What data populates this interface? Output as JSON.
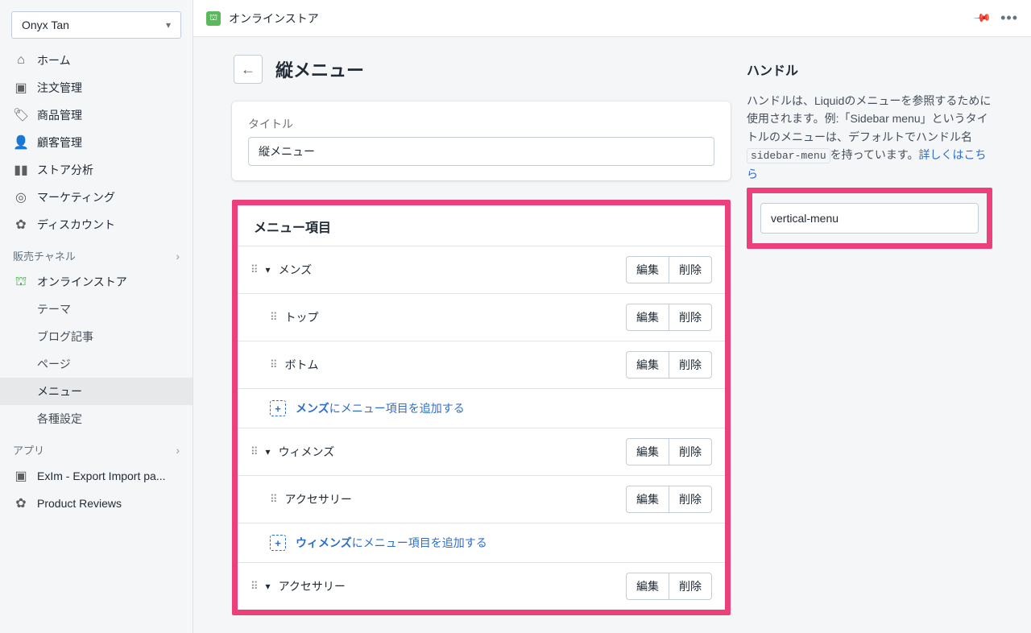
{
  "store_name": "Onyx Tan",
  "topbar": {
    "app_name": "オンラインストア"
  },
  "sidebar": {
    "nav": [
      {
        "label": "ホーム",
        "icon": "home"
      },
      {
        "label": "注文管理",
        "icon": "orders"
      },
      {
        "label": "商品管理",
        "icon": "products"
      },
      {
        "label": "顧客管理",
        "icon": "customers"
      },
      {
        "label": "ストア分析",
        "icon": "analytics"
      },
      {
        "label": "マーケティング",
        "icon": "marketing"
      },
      {
        "label": "ディスカウント",
        "icon": "discounts"
      }
    ],
    "channels_label": "販売チャネル",
    "channel": {
      "label": "オンラインストア",
      "sub": [
        {
          "label": "テーマ"
        },
        {
          "label": "ブログ記事"
        },
        {
          "label": "ページ"
        },
        {
          "label": "メニュー",
          "selected": true
        },
        {
          "label": "各種設定"
        }
      ]
    },
    "apps_label": "アプリ",
    "apps": [
      {
        "label": "ExIm - Export Import pa..."
      },
      {
        "label": "Product Reviews"
      }
    ]
  },
  "page": {
    "title": "縦メニュー",
    "title_field_label": "タイトル",
    "title_field_value": "縦メニュー",
    "menu_items_header": "メニュー項目",
    "edit_label": "編集",
    "delete_label": "削除",
    "items": [
      {
        "label": "メンズ",
        "children": [
          {
            "label": "トップ"
          },
          {
            "label": "ボトム"
          }
        ],
        "add_text_bold": "メンズ",
        "add_text_rest": "にメニュー項目を追加する"
      },
      {
        "label": "ウィメンズ",
        "children": [
          {
            "label": "アクセサリー"
          }
        ],
        "add_text_bold": "ウィメンズ",
        "add_text_rest": "にメニュー項目を追加する"
      },
      {
        "label": "アクセサリー",
        "children": []
      }
    ]
  },
  "handle_panel": {
    "title": "ハンドル",
    "desc_1": "ハンドルは、Liquidのメニューを参照するために使用されます。例:「Sidebar menu」というタイトルのメニューは、デフォルトでハンドル名",
    "code": "sidebar-menu",
    "desc_2": "を持っています。",
    "link": "詳しくはこちら",
    "value": "vertical-menu"
  }
}
